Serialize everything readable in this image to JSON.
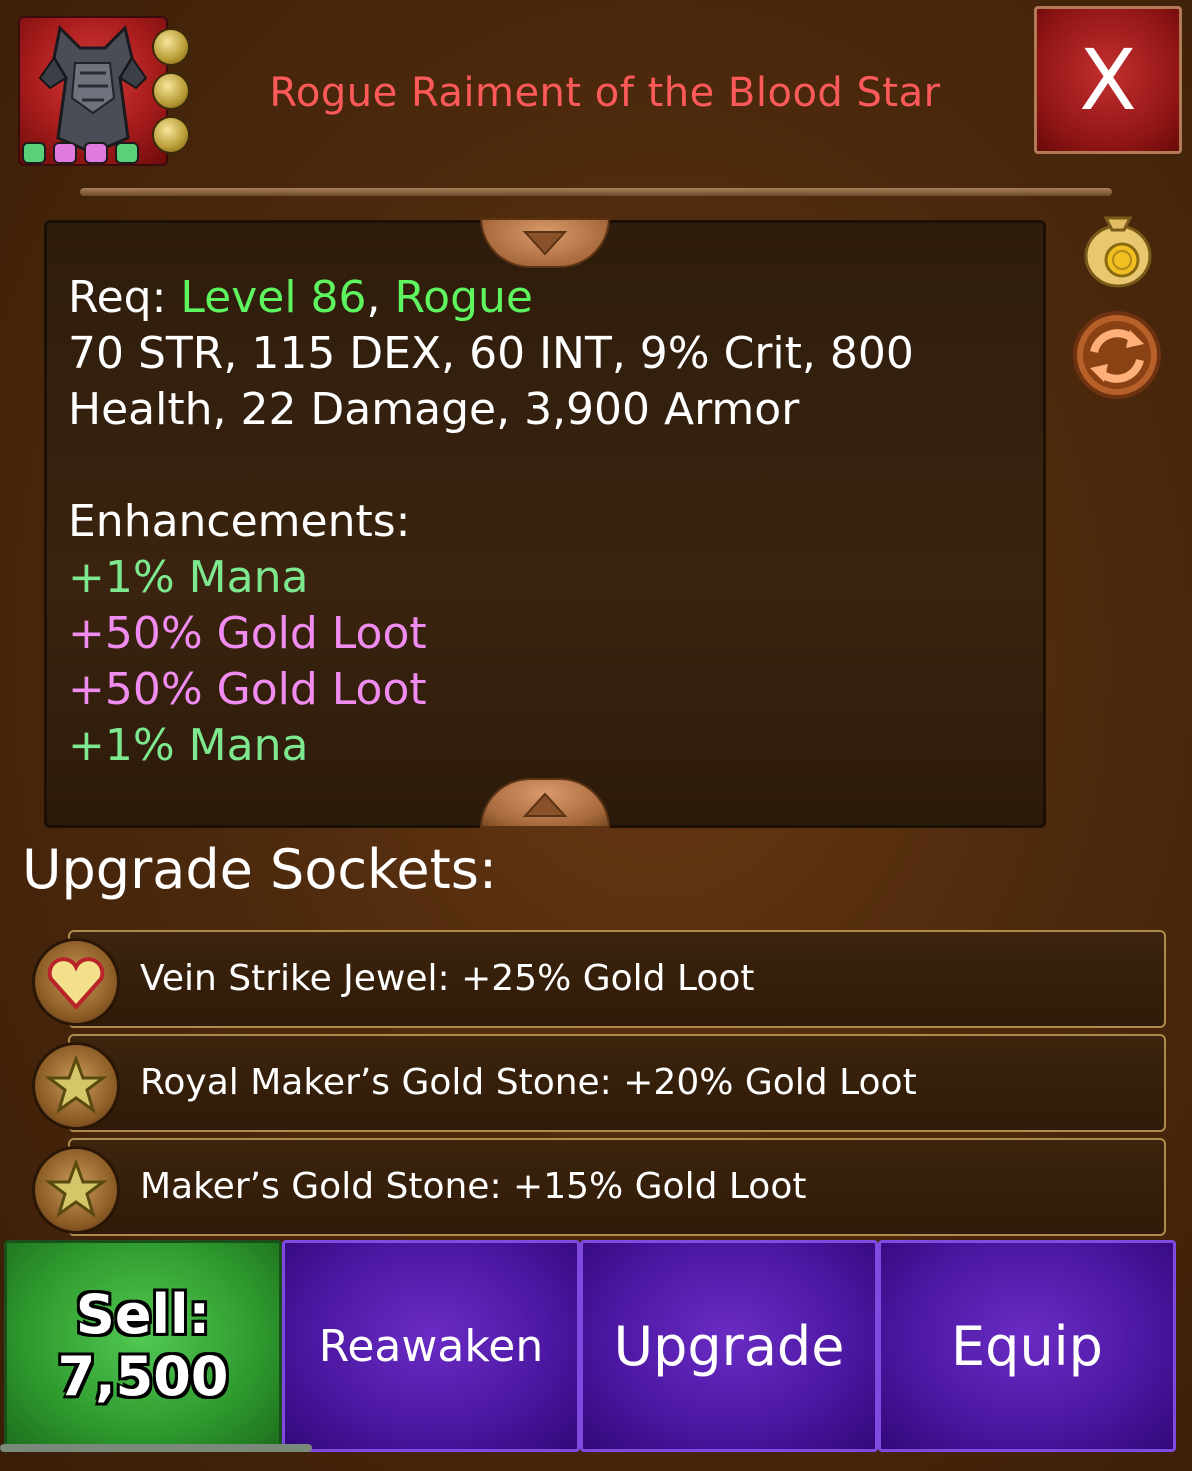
{
  "item": {
    "title": "Rogue Raiment of the Blood Star",
    "gem_slots": 3,
    "enhancement_pips": [
      "#5ad07a",
      "#e07ae0",
      "#e07ae0",
      "#5ad07a"
    ]
  },
  "close_label": "X",
  "stats": {
    "req_label": "Req:",
    "req_level": "Level 86",
    "req_sep": ",",
    "req_class": "Rogue",
    "line1": "70 STR, 115 DEX, 60 INT, 9% Crit, 800",
    "line2": "Health, 22 Damage, 3,900 Armor",
    "enhancements_heading": "Enhancements:",
    "enhancements": [
      "+1% Mana",
      "+50% Gold Loot",
      "+50% Gold Loot",
      "+1% Mana"
    ]
  },
  "sockets": {
    "heading": "Upgrade Sockets:",
    "items": [
      {
        "icon": "heart-jewel-icon",
        "text": "Vein Strike Jewel: +25% Gold Loot"
      },
      {
        "icon": "star-stone-icon",
        "text": "Royal Maker’s Gold Stone: +20% Gold Loot"
      },
      {
        "icon": "star-stone-icon",
        "text": "Maker’s Gold Stone: +15% Gold Loot"
      }
    ]
  },
  "actions": {
    "sell_label": "Sell:",
    "sell_value": "7,500",
    "reawaken": "Reawaken",
    "upgrade": "Upgrade",
    "equip": "Equip"
  },
  "colors": {
    "title_red": "#ff5a5a",
    "req_green": "#5ef55e",
    "enh_green": "#7ee88f",
    "enh_pink": "#f08cf0",
    "sell_green": "#2e9a2e",
    "action_purple": "#4a16a0"
  }
}
